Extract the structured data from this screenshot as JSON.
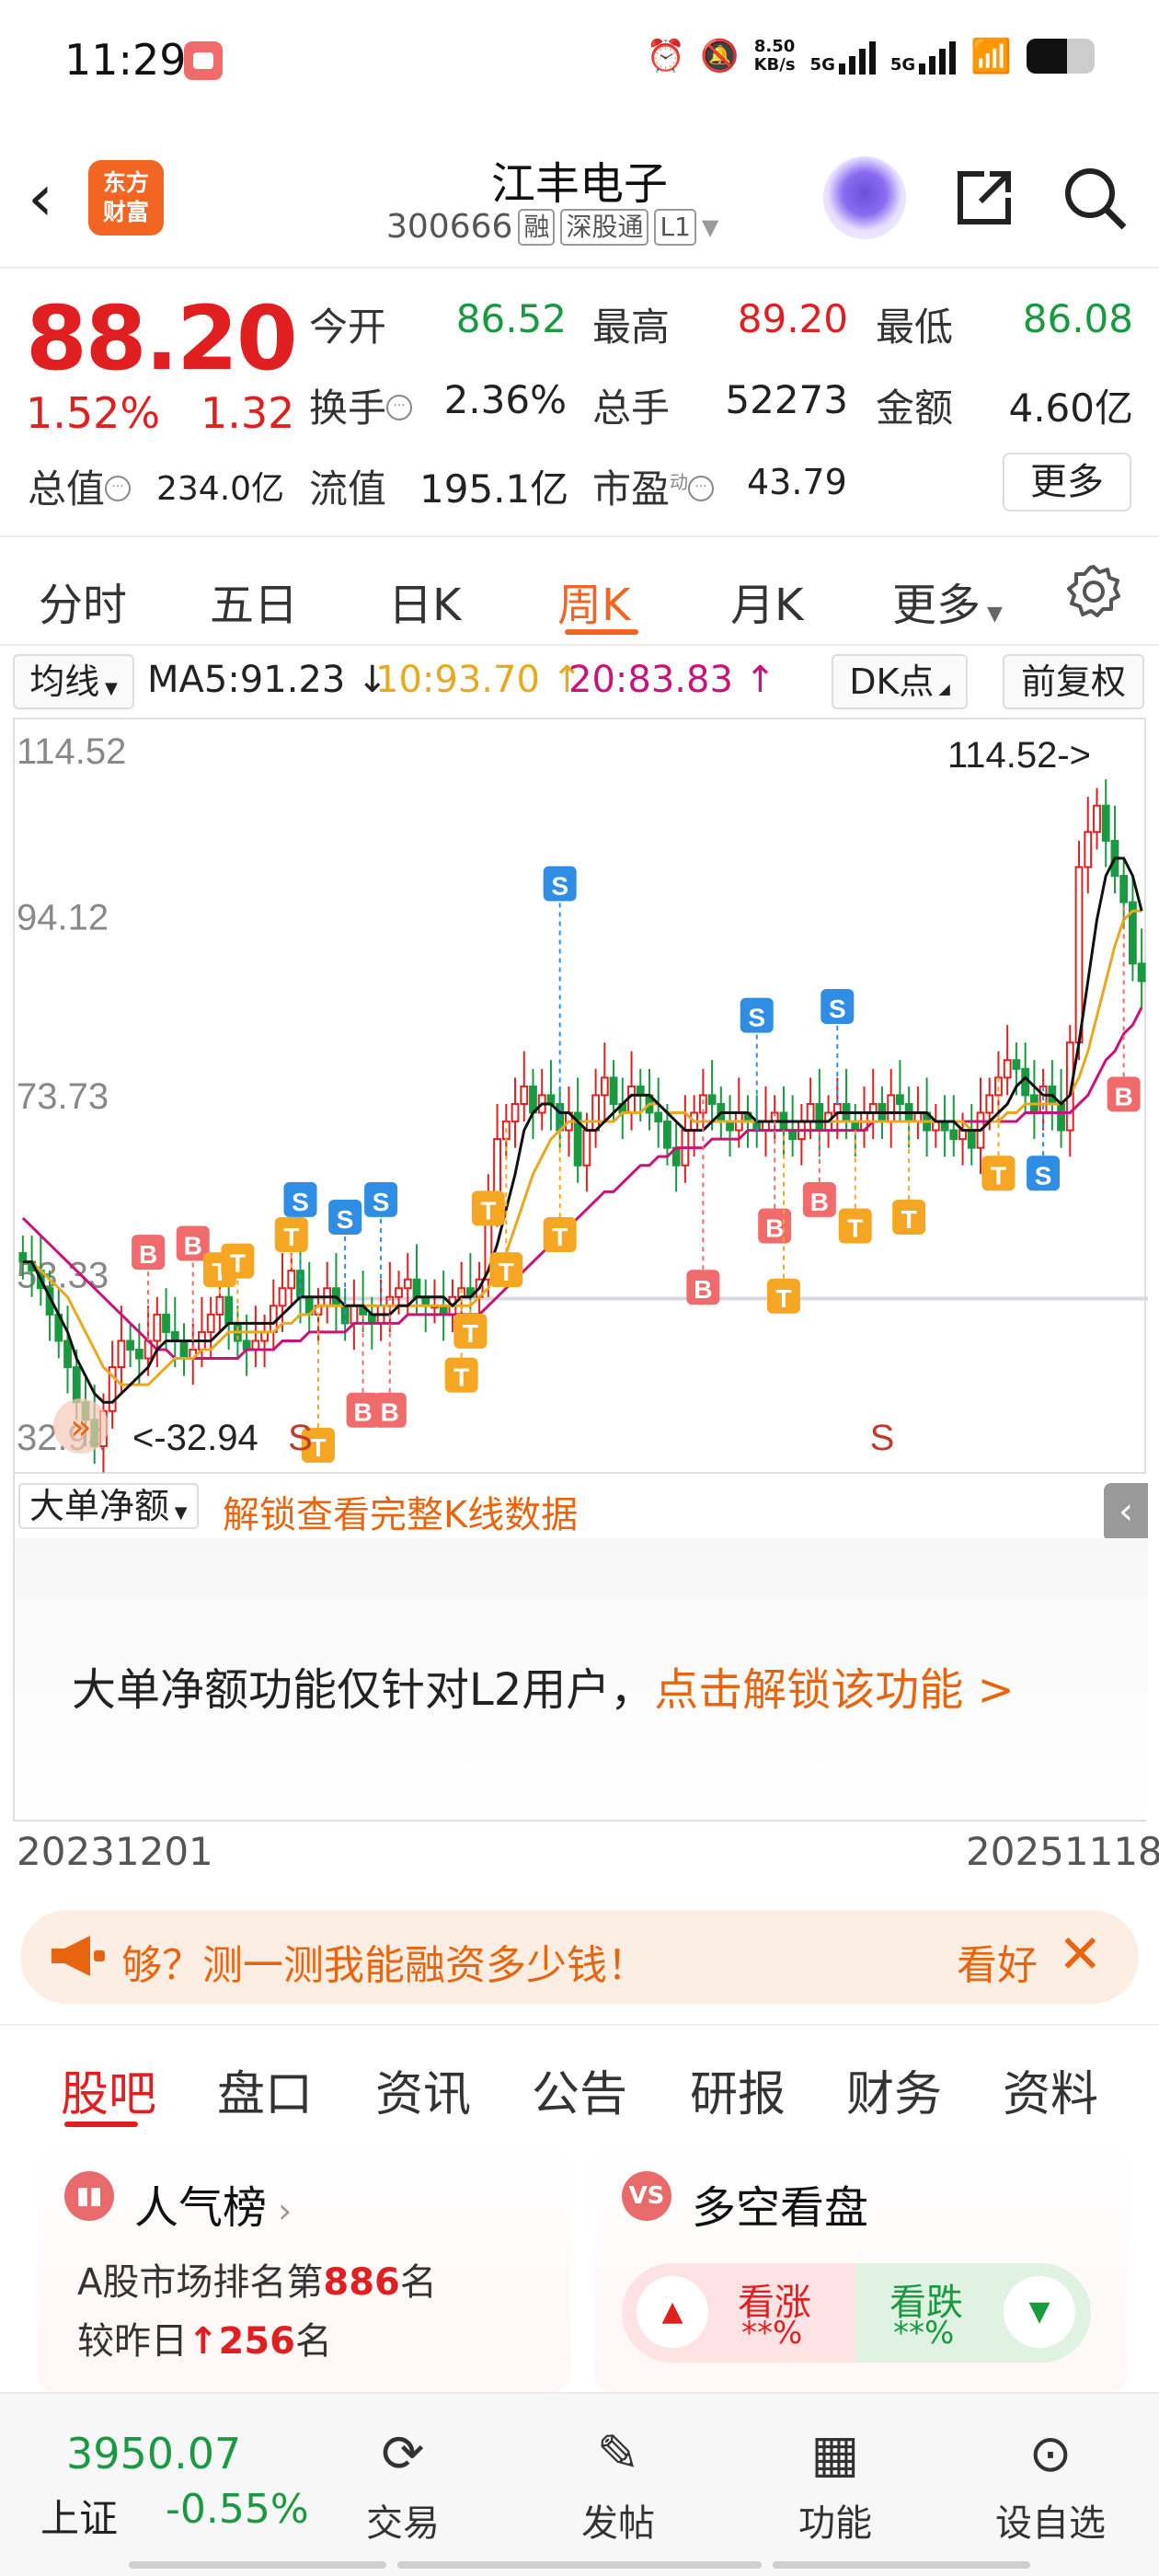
{
  "statusbar": {
    "time": "11:29",
    "net_speed_top": "8.50",
    "net_speed_bottom": "KB/s",
    "sim1": "5G",
    "sim2": "5G"
  },
  "header": {
    "logo_line1": "东方",
    "logo_line2": "财富",
    "stock_name": "江丰电子",
    "code": "300666",
    "tags": [
      "融",
      "深股通",
      "L1"
    ]
  },
  "quote": {
    "price": "88.20",
    "change_pct": "1.52%",
    "change_amt": "1.32",
    "fields": [
      {
        "label": "今开",
        "value": "86.52",
        "color": "#1a9a40"
      },
      {
        "label": "最高",
        "value": "89.20",
        "color": "#e02020"
      },
      {
        "label": "最低",
        "value": "86.08",
        "color": "#1a9a40"
      },
      {
        "label": "换手",
        "value": "2.36%",
        "color": "#222222"
      },
      {
        "label": "总手",
        "value": "52273",
        "color": "#222222"
      },
      {
        "label": "金额",
        "value": "4.60亿",
        "color": "#222222"
      }
    ],
    "total_mv_label": "总值",
    "total_mv": "234.0亿",
    "float_mv_label": "流值",
    "float_mv": "195.1亿",
    "pe_label": "市盈",
    "pe_sup": "动",
    "pe": "43.79",
    "more": "更多"
  },
  "tabs": [
    "分时",
    "五日",
    "日K",
    "周K",
    "月K",
    "更多"
  ],
  "active_tab": "周K",
  "ma": {
    "selector": "均线",
    "ma5": "MA5:91.23 ↓",
    "ma10": "10:93.70 ↑",
    "ma20": "20:83.83 ↑",
    "dk": "DK点",
    "adjust": "前复权"
  },
  "chart_data": {
    "type": "candlestick",
    "period": "weekly",
    "y_ticks": [
      "114.52",
      "94.12",
      "73.73",
      "53.33",
      "32.94"
    ],
    "ylim": [
      32.94,
      114.52
    ],
    "max_label": "114.52->",
    "min_label": "<-32.94",
    "start_date": "20231201",
    "end_date": "20251118",
    "close": [
      55,
      54,
      52,
      49,
      46,
      43,
      39,
      37,
      34,
      38,
      43,
      46,
      45,
      44,
      46,
      49,
      47,
      46,
      44,
      45,
      47,
      49,
      51,
      48,
      46,
      45,
      46,
      47,
      50,
      52,
      54,
      51,
      49,
      50,
      52,
      50,
      48,
      50,
      49,
      48,
      50,
      51,
      52,
      53,
      51,
      50,
      50,
      49,
      51,
      52,
      51,
      53,
      62,
      69,
      71,
      73,
      75,
      72,
      74,
      73,
      70,
      72,
      66,
      70,
      74,
      76,
      73,
      72,
      75,
      74,
      72,
      71,
      68,
      66,
      70,
      72,
      74,
      73,
      71,
      70,
      72,
      71,
      70,
      71,
      72,
      70,
      69,
      71,
      73,
      70,
      72,
      73,
      71,
      70,
      72,
      73,
      71,
      74,
      73,
      71,
      72,
      70,
      71,
      70,
      69,
      70,
      68,
      72,
      74,
      76,
      78,
      77,
      74,
      72,
      75,
      73,
      70,
      80,
      100,
      104,
      107,
      103,
      99,
      96,
      89,
      87
    ],
    "ma5": [
      55,
      55,
      53,
      51,
      49,
      47,
      44,
      42,
      40,
      39,
      39,
      40,
      41,
      42,
      43,
      45,
      46,
      46,
      46,
      46,
      46,
      46,
      47,
      48,
      48,
      48,
      48,
      48,
      48,
      49,
      50,
      51,
      51,
      51,
      51,
      51,
      50,
      50,
      50,
      49,
      49,
      49,
      50,
      50,
      51,
      51,
      51,
      51,
      50,
      51,
      51,
      52,
      54,
      57,
      61,
      65,
      70,
      72,
      73,
      73,
      72,
      72,
      71,
      70,
      70,
      71,
      72,
      73,
      74,
      74,
      74,
      73,
      72,
      71,
      70,
      70,
      70,
      71,
      72,
      72,
      72,
      72,
      71,
      71,
      71,
      71,
      71,
      71,
      71,
      71,
      71,
      72,
      72,
      72,
      72,
      72,
      72,
      72,
      72,
      72,
      72,
      72,
      71,
      71,
      71,
      70,
      70,
      70,
      71,
      72,
      73,
      75,
      76,
      75,
      74,
      74,
      73,
      74,
      80,
      87,
      94,
      99,
      101,
      101,
      99,
      95
    ],
    "ma10": [
      55,
      55,
      54,
      53,
      52,
      51,
      49,
      47,
      45,
      43,
      42,
      41,
      41,
      41,
      41,
      42,
      43,
      44,
      44,
      44,
      45,
      45,
      46,
      47,
      47,
      47,
      47,
      47,
      47,
      48,
      48,
      49,
      49,
      50,
      50,
      50,
      50,
      50,
      50,
      50,
      50,
      50,
      50,
      50,
      50,
      50,
      50,
      50,
      50,
      50,
      50,
      51,
      52,
      54,
      56,
      59,
      62,
      65,
      67,
      69,
      70,
      71,
      71,
      71,
      71,
      71,
      71,
      72,
      72,
      72,
      73,
      73,
      72,
      72,
      72,
      71,
      71,
      71,
      71,
      71,
      71,
      71,
      71,
      71,
      71,
      71,
      71,
      71,
      71,
      71,
      71,
      71,
      71,
      71,
      71,
      71,
      71,
      71,
      71,
      71,
      71,
      71,
      71,
      71,
      71,
      71,
      70,
      70,
      71,
      71,
      72,
      72,
      73,
      73,
      73,
      73,
      73,
      74,
      76,
      79,
      83,
      87,
      91,
      94,
      95,
      95
    ],
    "ma20": [
      60,
      59,
      58,
      57,
      56,
      55,
      54,
      53,
      52,
      51,
      50,
      49,
      48,
      47,
      46,
      45,
      45,
      44,
      44,
      44,
      44,
      44,
      44,
      44,
      44,
      45,
      45,
      45,
      45,
      46,
      46,
      46,
      47,
      47,
      47,
      47,
      47,
      48,
      48,
      48,
      48,
      48,
      48,
      49,
      49,
      49,
      49,
      49,
      49,
      49,
      49,
      49,
      50,
      51,
      52,
      53,
      54,
      55,
      56,
      57,
      58,
      59,
      60,
      61,
      62,
      63,
      63,
      64,
      65,
      66,
      66,
      67,
      67,
      68,
      68,
      68,
      68,
      69,
      69,
      69,
      69,
      70,
      70,
      70,
      70,
      70,
      70,
      70,
      70,
      70,
      70,
      70,
      70,
      70,
      70,
      71,
      71,
      71,
      71,
      71,
      71,
      71,
      71,
      71,
      71,
      71,
      71,
      71,
      71,
      71,
      71,
      71,
      72,
      72,
      72,
      72,
      72,
      72,
      73,
      74,
      76,
      78,
      79,
      81,
      82,
      84
    ],
    "markers": [
      {
        "type": "B",
        "i": 14,
        "price": 56
      },
      {
        "type": "B",
        "i": 19,
        "price": 57
      },
      {
        "type": "T",
        "i": 22,
        "price": 54
      },
      {
        "type": "T",
        "i": 24,
        "price": 55
      },
      {
        "type": "S",
        "i": 31,
        "price": 62
      },
      {
        "type": "T",
        "i": 30,
        "price": 58
      },
      {
        "type": "S",
        "i": 36,
        "price": 60
      },
      {
        "type": "S",
        "i": 40,
        "price": 62
      },
      {
        "type": "T",
        "i": 33,
        "price": 34
      },
      {
        "type": "B",
        "i": 38,
        "price": 38
      },
      {
        "type": "B",
        "i": 41,
        "price": 38
      },
      {
        "type": "T",
        "i": 49,
        "price": 42
      },
      {
        "type": "T",
        "i": 50,
        "price": 47
      },
      {
        "type": "T",
        "i": 52,
        "price": 61
      },
      {
        "type": "T",
        "i": 54,
        "price": 54
      },
      {
        "type": "T",
        "i": 60,
        "price": 58
      },
      {
        "type": "S",
        "i": 60,
        "price": 98
      },
      {
        "type": "B",
        "i": 76,
        "price": 52
      },
      {
        "type": "B",
        "i": 84,
        "price": 59
      },
      {
        "type": "T",
        "i": 85,
        "price": 51
      },
      {
        "type": "S",
        "i": 82,
        "price": 83
      },
      {
        "type": "S",
        "i": 91,
        "price": 84
      },
      {
        "type": "B",
        "i": 89,
        "price": 62
      },
      {
        "type": "T",
        "i": 93,
        "price": 59
      },
      {
        "type": "T",
        "i": 99,
        "price": 60
      },
      {
        "type": "T",
        "i": 109,
        "price": 65
      },
      {
        "type": "S",
        "i": 114,
        "price": 65
      },
      {
        "type": "B",
        "i": 123,
        "price": 74
      }
    ],
    "sell_labels": [
      {
        "text": "S",
        "i": 31
      },
      {
        "text": "S",
        "i": 96
      }
    ]
  },
  "flow": {
    "selector": "大单净额",
    "lock_text": "解锁查看完整K线数据",
    "message": "大单净额功能仅针对L2用户，",
    "link": "点击解锁该功能 >"
  },
  "banner": {
    "text": "够？测一测我能融资多少钱！",
    "look": "看好"
  },
  "subtabs": [
    "股吧",
    "盘口",
    "资讯",
    "公告",
    "研报",
    "财务",
    "资料"
  ],
  "popularity": {
    "title": "人气榜",
    "line1_pre": "A股市场排名第",
    "rank": "886",
    "line1_post": "名",
    "line2_pre": "较昨日",
    "delta": "256",
    "line2_post": "名"
  },
  "bullbear": {
    "title": "多空看盘",
    "up_label": "看涨",
    "up_pct": "**%",
    "down_label": "看跌",
    "down_pct": "**%"
  },
  "bottom": {
    "index_value": "3950.07",
    "index_name": "上证",
    "index_change": "-0.55%",
    "nav": [
      "交易",
      "发帖",
      "功能",
      "设自选"
    ]
  }
}
